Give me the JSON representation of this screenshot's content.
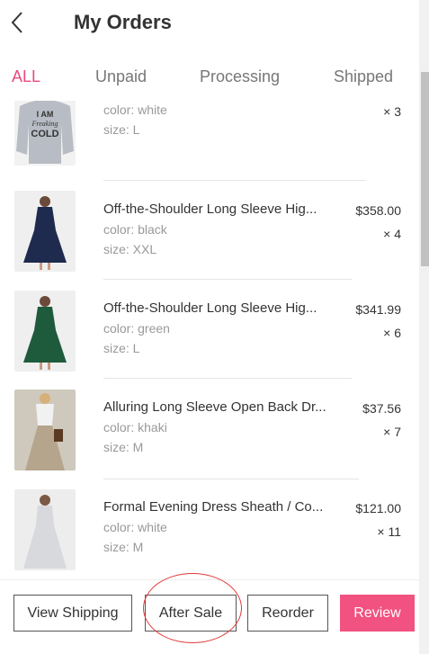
{
  "header": {
    "title": "My Orders",
    "back_icon": "chevron-left-icon"
  },
  "tabs": [
    {
      "label": "ALL",
      "active": true
    },
    {
      "label": "Unpaid",
      "active": false
    },
    {
      "label": "Processing",
      "active": false
    },
    {
      "label": "Shipped",
      "active": false
    }
  ],
  "items": [
    {
      "name": "",
      "color": "color: white",
      "size": "size: L",
      "price": "",
      "qty": "× 3",
      "thumb": "sweatshirt-image"
    },
    {
      "name": "Off-the-Shoulder Long Sleeve Hig...",
      "color": "color: black",
      "size": "size: XXL",
      "price": "$358.00",
      "qty": "× 4",
      "thumb": "dress-image"
    },
    {
      "name": "Off-the-Shoulder Long Sleeve Hig...",
      "color": "color: green",
      "size": "size: L",
      "price": "$341.99",
      "qty": "× 6",
      "thumb": "dress-image"
    },
    {
      "name": "Alluring Long Sleeve Open Back Dr...",
      "color": "color: khaki",
      "size": "size: M",
      "price": "$37.56",
      "qty": "× 7",
      "thumb": "dress-image"
    },
    {
      "name": "Formal Evening Dress Sheath / Co...",
      "color": "color: white",
      "size": "size: M",
      "price": "$121.00",
      "qty": "× 11",
      "thumb": "gown-image"
    }
  ],
  "sweatshirt_print": [
    "I AM",
    "Freaking",
    "COLD"
  ],
  "footer": {
    "view_shipping": "View Shipping",
    "after_sale": "After Sale",
    "reorder": "Reorder",
    "review": "Review"
  },
  "colors": {
    "accent": "#e84a7f",
    "primary_button": "#f2527f",
    "annotation_circle": "#e23a3a"
  }
}
